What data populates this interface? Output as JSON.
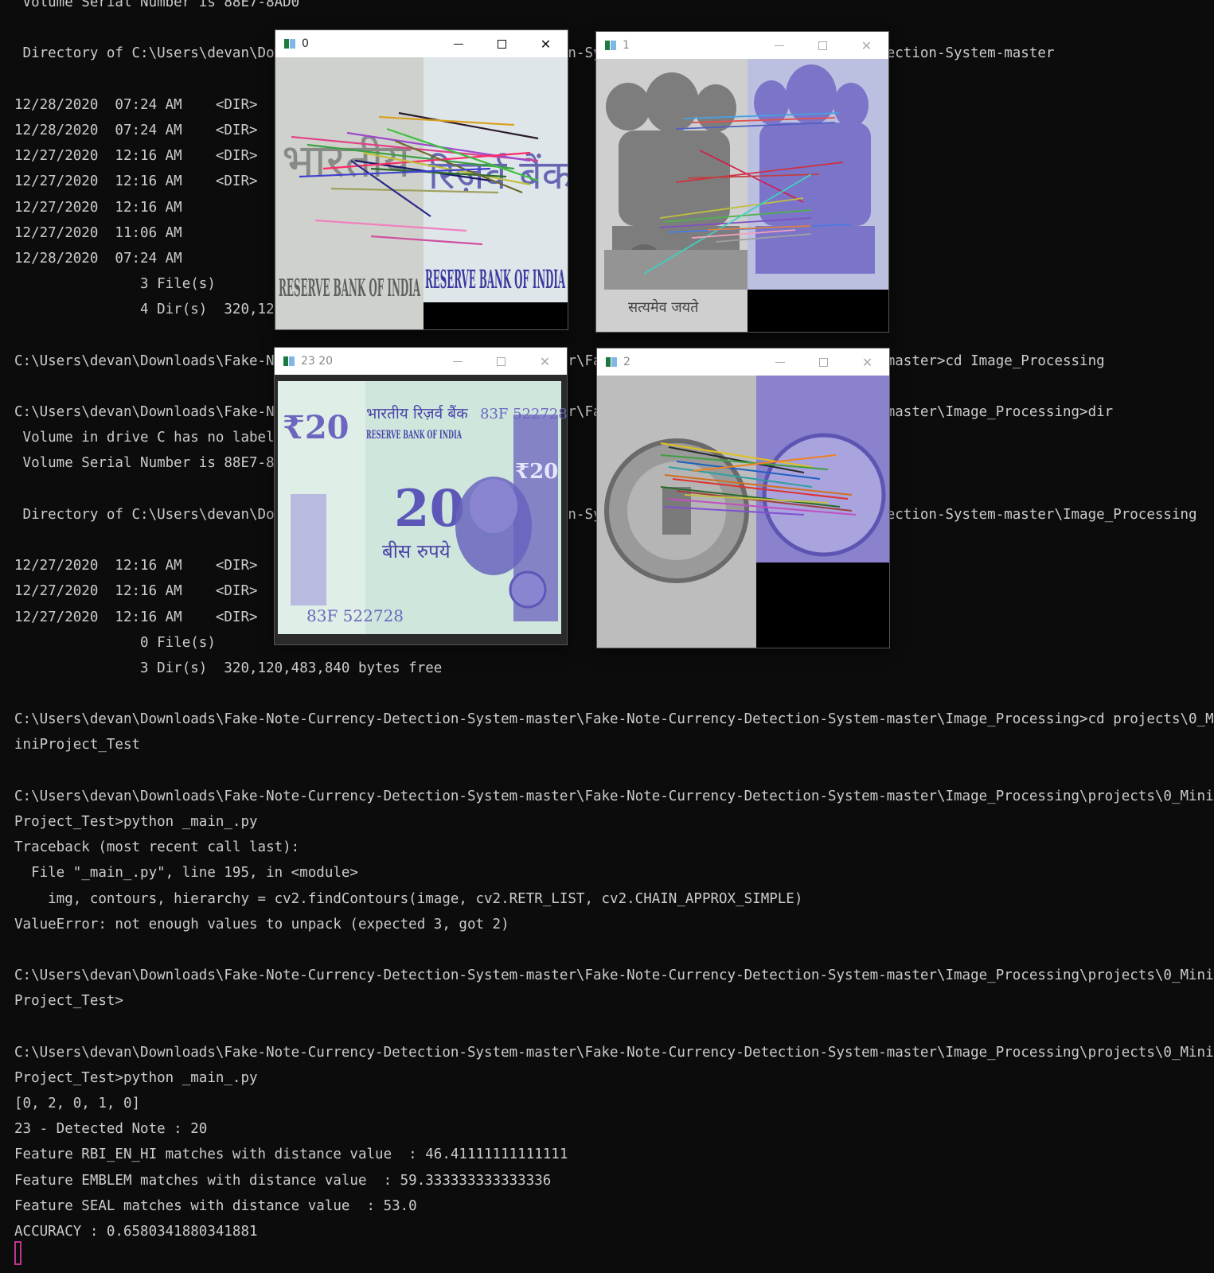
{
  "terminal": {
    "lines": [
      " Volume Serial Number is 88E7-8AD0",
      "",
      " Directory of C:\\Users\\devan\\Downloads\\Fake-Note-Currency-Detection-System-master\\Fake-Note-Currency-Detection-System-master",
      "",
      "12/28/2020  07:24 AM    <DIR>",
      "12/28/2020  07:24 AM    <DIR>",
      "12/27/2020  12:16 AM    <DIR>",
      "12/27/2020  12:16 AM    <DIR>",
      "12/27/2020  12:16 AM",
      "12/27/2020  11:06 AM",
      "12/28/2020  07:24 AM",
      "               3 File(s)",
      "               4 Dir(s)  320,120,483,840 bytes free",
      "",
      "C:\\Users\\devan\\Downloads\\Fake-Note-Currency-Detection-System-master\\Fake-Note-Currency-Detection-System-master>cd Image_Processing",
      "",
      "C:\\Users\\devan\\Downloads\\Fake-Note-Currency-Detection-System-master\\Fake-Note-Currency-Detection-System-master\\Image_Processing>dir",
      " Volume in drive C has no label.",
      " Volume Serial Number is 88E7-8AD0",
      "",
      " Directory of C:\\Users\\devan\\Downloads\\Fake-Note-Currency-Detection-System-master\\Fake-Note-Currency-Detection-System-master\\Image_Processing",
      "",
      "12/27/2020  12:16 AM    <DIR>",
      "12/27/2020  12:16 AM    <DIR>",
      "12/27/2020  12:16 AM    <DIR>",
      "               0 File(s)",
      "               3 Dir(s)  320,120,483,840 bytes free",
      "",
      "C:\\Users\\devan\\Downloads\\Fake-Note-Currency-Detection-System-master\\Fake-Note-Currency-Detection-System-master\\Image_Processing>cd projects\\0_M",
      "iniProject_Test",
      "",
      "C:\\Users\\devan\\Downloads\\Fake-Note-Currency-Detection-System-master\\Fake-Note-Currency-Detection-System-master\\Image_Processing\\projects\\0_Mini",
      "Project_Test>python _main_.py",
      "Traceback (most recent call last):",
      "  File \"_main_.py\", line 195, in <module>",
      "    img, contours, hierarchy = cv2.findContours(image, cv2.RETR_LIST, cv2.CHAIN_APPROX_SIMPLE)",
      "ValueError: not enough values to unpack (expected 3, got 2)",
      "",
      "C:\\Users\\devan\\Downloads\\Fake-Note-Currency-Detection-System-master\\Fake-Note-Currency-Detection-System-master\\Image_Processing\\projects\\0_Mini",
      "Project_Test>",
      "",
      "C:\\Users\\devan\\Downloads\\Fake-Note-Currency-Detection-System-master\\Fake-Note-Currency-Detection-System-master\\Image_Processing\\projects\\0_Mini",
      "Project_Test>python _main_.py",
      "[0, 2, 0, 1, 0]",
      "23 - Detected Note : 20",
      "Feature RBI_EN_HI matches with distance value  : 46.41111111111111",
      "Feature EMBLEM matches with distance value  : 59.333333333333336",
      "Feature SEAL matches with distance value  : 53.0",
      "ACCURACY : 0.6580341880341881"
    ]
  },
  "windows": {
    "w0": {
      "title": "0",
      "state": "active",
      "content": "rbi-text-feature-matches"
    },
    "w1": {
      "title": "1",
      "state": "inactive",
      "content": "emblem-feature-matches"
    },
    "w2": {
      "title": "23 20",
      "state": "inactive",
      "content": "twenty-rupee-note"
    },
    "w3": {
      "title": "2",
      "state": "inactive",
      "content": "seal-feature-matches"
    }
  },
  "note": {
    "hindi_bank": "भारतीय रिज़र्व बैंक",
    "english_bank": "RESERVE BANK OF INDIA",
    "serial": "83F 522728",
    "denomination": "₹20",
    "numeral": "20",
    "hindi_value": "बीस रुपये"
  },
  "rbi_crop": {
    "english": "RESERVE BANK OF INDIA",
    "hindi": "भारतीय रिज़र्व बैंक"
  },
  "emblem_crop": {
    "motto": "सत्यमेव जयते"
  },
  "colors": {
    "terminal_bg": "#0c0c0c",
    "terminal_fg": "#cccccc",
    "cursor": "#c0358e",
    "note_purple": "#7c76c9"
  }
}
